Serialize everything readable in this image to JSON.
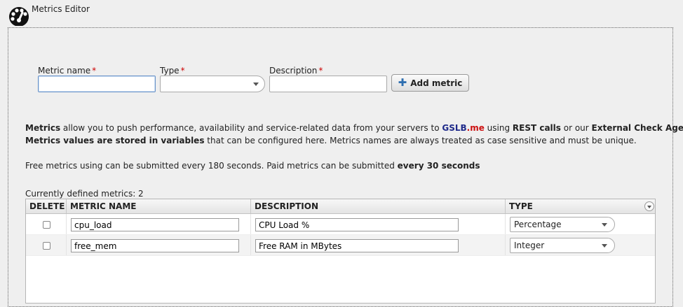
{
  "header": {
    "title": "Metrics Editor",
    "logo_icon": "speedometer-icon"
  },
  "form": {
    "name_label": "Metric name",
    "type_label": "Type",
    "description_label": "Description",
    "required_mark": "*",
    "name_value": "",
    "type_value": "",
    "description_value": "",
    "add_button_label": "Add metric",
    "add_icon": "plus-icon"
  },
  "info": {
    "line1": {
      "p1": "Metrics",
      "p2": " allow you to push performance, availability and service-related data from your servers to ",
      "brand_a": "GSLB",
      "brand_b": ".me",
      "p3": " using ",
      "p4": "REST calls",
      "p5": " or our ",
      "p6": "External Check Agent"
    },
    "line2": {
      "p1": "Metrics values are stored in variables",
      "p2": " that can be configured here. Metrics names are always treated as case sensitive and must be unique."
    },
    "line3": {
      "p1": "Free metrics using can be submitted every 180 seconds. Paid metrics can be submitted ",
      "p2": "every 30 seconds"
    }
  },
  "table": {
    "count_label": "Currently defined metrics: 2",
    "columns": [
      "DELETE",
      "METRIC NAME",
      "DESCRIPTION",
      "TYPE"
    ],
    "rows": [
      {
        "name": "cpu_load",
        "description": "CPU Load %",
        "type": "Percentage",
        "checked": false
      },
      {
        "name": "free_mem",
        "description": "Free RAM in MBytes",
        "type": "Integer",
        "checked": false
      }
    ]
  },
  "colors": {
    "brand_blue": "#1f2a8a",
    "brand_red": "#cc1010",
    "required_red": "#cc0000",
    "accent_blue": "#2f6fb0"
  }
}
